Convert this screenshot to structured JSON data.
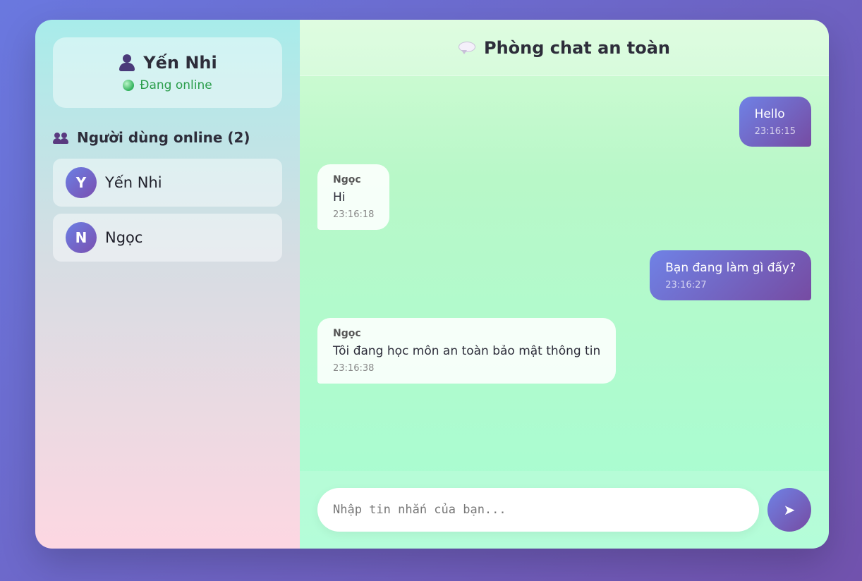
{
  "profile": {
    "name": "Yến Nhi",
    "status": "Đang online",
    "icon": "user-icon"
  },
  "online_users": {
    "heading": "Người dùng online (2)",
    "icon": "users-icon",
    "users": [
      {
        "initial": "Y",
        "name": "Yến Nhi"
      },
      {
        "initial": "N",
        "name": "Ngọc"
      }
    ]
  },
  "chat": {
    "title": "Phòng chat an toàn",
    "icon": "speech-bubble-icon",
    "messages": [
      {
        "type": "sent",
        "text": "Hello",
        "time": "23:16:15"
      },
      {
        "type": "recv",
        "sender": "Ngọc",
        "text": "Hi",
        "time": "23:16:18"
      },
      {
        "type": "sent",
        "text": "Bạn đang làm gì đấy?",
        "time": "23:16:27"
      },
      {
        "type": "recv",
        "sender": "Ngọc",
        "text": "Tôi đang học môn an toàn bảo mật thông tin",
        "time": "23:16:38"
      }
    ]
  },
  "composer": {
    "placeholder": "Nhập tin nhắn của bạn...",
    "send_icon": "➤"
  },
  "colors": {
    "accent_start": "#6f82e6",
    "accent_end": "#764ba2",
    "online_green": "#2a9d4a"
  }
}
